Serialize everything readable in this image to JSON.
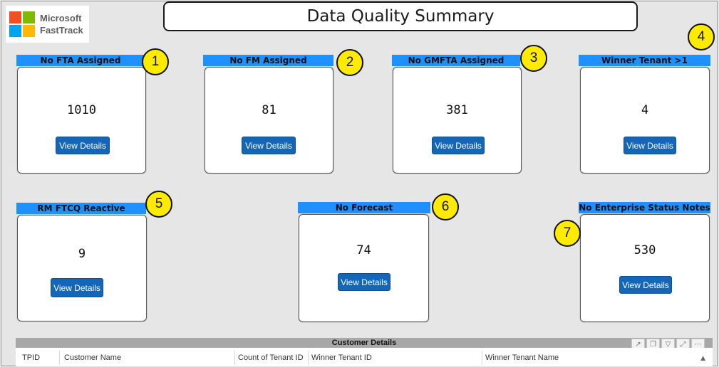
{
  "logo": {
    "line1": "Microsoft",
    "line2": "FastTrack",
    "colors": [
      "#f25022",
      "#7fba00",
      "#00a4ef",
      "#ffb900"
    ]
  },
  "title": "Data Quality Summary",
  "button_label": "View Details",
  "kpis": [
    {
      "label": "No FTA Assigned",
      "value": "1010",
      "badge": "1"
    },
    {
      "label": "No FM Assigned",
      "value": "81",
      "badge": "2"
    },
    {
      "label": "No GMFTA Assigned",
      "value": "381",
      "badge": "3"
    },
    {
      "label": "Winner Tenant >1",
      "value": "4",
      "badge": "4"
    },
    {
      "label": "RM FTCQ Reactive",
      "value": "9",
      "badge": "5"
    },
    {
      "label": "No Forecast",
      "value": "74",
      "badge": "6"
    },
    {
      "label": "No Enterprise Status Notes",
      "value": "530",
      "badge": "7"
    }
  ],
  "table": {
    "title": "Customer Details",
    "columns": [
      "TPID",
      "Customer Name",
      "Count of Tenant ID",
      "Winner Tenant ID",
      "Winner Tenant Name"
    ],
    "toolbar_icons": [
      "pin-icon",
      "copy-icon",
      "filter-icon",
      "focus-mode-icon",
      "more-options-icon"
    ]
  },
  "colors": {
    "header_blue": "#1e90ff",
    "button_blue": "#1366b8",
    "badge_yellow": "#ffeb00",
    "background": "#e6e6e6"
  }
}
